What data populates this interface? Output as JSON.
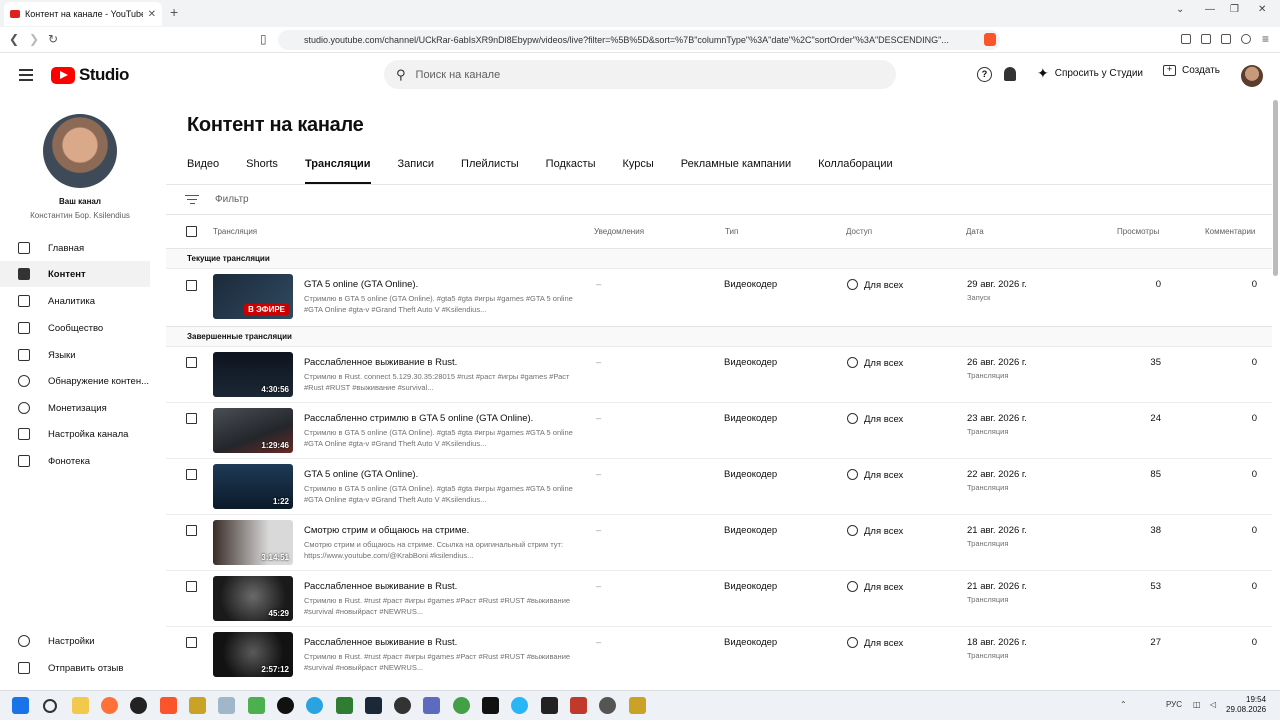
{
  "browser": {
    "tab_title": "Контент на канале - YouTube Studio",
    "url": "studio.youtube.com/channel/UCkRar-6abIsXR9nDl8Ebypw/videos/live?filter=%5B%5D&sort=%7B\"columnType\"%3A\"date\"%2C\"sortOrder\"%3A\"DESCENDING\"...",
    "new_tab": "+",
    "close": "✕"
  },
  "header": {
    "logo_text": "Studio",
    "search_placeholder": "Поиск на канале",
    "help": "?",
    "ask_studio": "Спросить у Студии",
    "create": "Создать"
  },
  "sidebar": {
    "your_channel": "Ваш канал",
    "channel_name": "Константин Бор. Ksilendius",
    "items": [
      {
        "label": "Главная",
        "icon": "dashboard-icon"
      },
      {
        "label": "Контент",
        "icon": "content-icon",
        "active": true
      },
      {
        "label": "Аналитика",
        "icon": "analytics-icon"
      },
      {
        "label": "Сообщество",
        "icon": "community-icon"
      },
      {
        "label": "Языки",
        "icon": "subtitles-icon"
      },
      {
        "label": "Обнаружение контен...",
        "icon": "copyright-icon"
      },
      {
        "label": "Монетизация",
        "icon": "monetization-icon"
      },
      {
        "label": "Настройка канала",
        "icon": "customization-icon"
      },
      {
        "label": "Фонотека",
        "icon": "audio-library-icon"
      }
    ],
    "settings": "Настройки",
    "feedback": "Отправить отзыв"
  },
  "main": {
    "title": "Контент на канале",
    "tabs": [
      "Видео",
      "Shorts",
      "Трансляции",
      "Записи",
      "Плейлисты",
      "Подкасты",
      "Курсы",
      "Рекламные кампании",
      "Коллаборации"
    ],
    "active_tab": "Трансляции",
    "filter_placeholder": "Фильтр",
    "columns": {
      "stream": "Трансляция",
      "notifications": "Уведомления",
      "type": "Тип",
      "access": "Доступ",
      "date": "Дата",
      "views": "Просмотры",
      "comments": "Комментарии"
    },
    "section_current": "Текущие трансляции",
    "section_finished": "Завершенные трансляции",
    "live_row": {
      "title": "GTA 5 online (GTA Online).",
      "desc": "Стримлю в GTA 5 online (GTA Online). #gta5 #gta #игры #games #GTA 5 online #GTA Online #gta-v #Grand Theft Auto V #Ksilendius...",
      "badge": "В ЭФИРЕ",
      "notif": "–",
      "type": "Видеокодер",
      "access": "Для всех",
      "date": "29 авг. 2026 г.",
      "date_sub": "Запуск",
      "views": "0",
      "comments": "0"
    },
    "rows": [
      {
        "title": "Расслабленное выживание в Rust.",
        "desc": "Стримлю в Rust. connect 5.129.30.35:28015 #rust #раст #игры #games #Раст #Rust #RUST #выживание #survival...",
        "duration": "4:30:56",
        "notif": "–",
        "type": "Видеокодер",
        "access": "Для всех",
        "date": "26 авг. 2026 г.",
        "date_sub": "Трансляция",
        "views": "35",
        "comments": "0"
      },
      {
        "title": "Расслабленно стримлю в GTA 5 online (GTA Online).",
        "desc": "Стримлю в GTA 5 online (GTA Online). #gta5 #gta #игры #games #GTA 5 online #GTA Online #gta-v #Grand Theft Auto V #Ksilendius...",
        "duration": "1:29:46",
        "notif": "–",
        "type": "Видеокодер",
        "access": "Для всех",
        "date": "23 авг. 2026 г.",
        "date_sub": "Трансляция",
        "views": "24",
        "comments": "0"
      },
      {
        "title": "GTA 5 online (GTA Online).",
        "desc": "Стримлю в GTA 5 online (GTA Online). #gta5 #gta #игры #games #GTA 5 online #GTA Online #gta-v #Grand Theft Auto V #Ksilendius...",
        "duration": "1:22",
        "notif": "–",
        "type": "Видеокодер",
        "access": "Для всех",
        "date": "22 авг. 2026 г.",
        "date_sub": "Трансляция",
        "views": "85",
        "comments": "0"
      },
      {
        "title": "Смотрю стрим и общаюсь на стриме.",
        "desc": "Смотрю стрим и общаюсь на стриме. Ссылка на оригинальный стрим тут: https://www.youtube.com/@KrabBoni #ksilendius...",
        "duration": "3:14:51",
        "notif": "–",
        "type": "Видеокодер",
        "access": "Для всех",
        "date": "21 авг. 2026 г.",
        "date_sub": "Трансляция",
        "views": "38",
        "comments": "0"
      },
      {
        "title": "Расслабленное выживание в Rust.",
        "desc": "Стримлю в Rust. #rust #раст #игры #games #Раст #Rust #RUST #выживание #survival #новыйраст #NEWRUS...",
        "duration": "45:29",
        "notif": "–",
        "type": "Видеокодер",
        "access": "Для всех",
        "date": "21 авг. 2026 г.",
        "date_sub": "Трансляция",
        "views": "53",
        "comments": "0"
      },
      {
        "title": "Расслабленное выживание в Rust.",
        "desc": "Стримлю в Rust. #rust #раст #игры #games #Раст #Rust #RUST #выживание #survival #новыйраст #NEWRUS...",
        "duration": "2:57:12",
        "notif": "–",
        "type": "Видеокодер",
        "access": "Для всех",
        "date": "18 авг. 2026 г.",
        "date_sub": "Трансляция",
        "views": "27",
        "comments": "0"
      }
    ]
  },
  "taskbar": {
    "lang": "РУС",
    "time": "19:54",
    "date": "29.08.2026"
  }
}
